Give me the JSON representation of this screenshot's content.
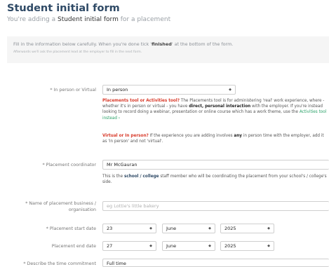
{
  "header": {
    "title": "Student initial form",
    "subtitle_pre": "You're adding a ",
    "subtitle_strong": "Student initial form",
    "subtitle_post": " for a placement"
  },
  "info": {
    "line1_pre": "Fill in the information below carefully. When you're done tick '",
    "line1_strong": "finished",
    "line1_post": "' at the bottom of the form.",
    "line2": "Afterwards we'll ask the placement lead at the employer to fill in the next form."
  },
  "fields": {
    "mode": {
      "label": "* In person or Virtual",
      "value": "In person"
    },
    "coordinator": {
      "label": "* Placement coordinator",
      "value": "Mr McGauran"
    },
    "business": {
      "label": "* Name of placement business / organisation",
      "placeholder": "eg Lottie's little bakery"
    },
    "start": {
      "label": "* Placement start date",
      "day": "23",
      "month": "June",
      "year": "2025"
    },
    "end": {
      "label": "Placement end date",
      "day": "27",
      "month": "June",
      "year": "2025"
    },
    "commitment": {
      "label": "* Describe the time commitment",
      "value": "Full time"
    }
  },
  "help": {
    "tool": {
      "title": "Placements tool or Activities tool?",
      "t1": " The Placements tool is for administering 'real' work experience, where - whether it's in person or virtual - you have ",
      "strong": "direct, personal interaction",
      "t2": " with the employer. If you're instead looking to record doing a webinar, presentation or online course which has a work theme, use the ",
      "link": "Activities tool instead ›"
    },
    "virtual": {
      "title": "Virtual or In person?",
      "t1": " If the experience you are adding involves ",
      "strong": "any",
      "t2": " in person time with the employer, add it as 'In person' and not 'virtual'."
    },
    "coordinator": {
      "t1": "This is the ",
      "strong": "school / college",
      "t2": " staff member who will be coordinating the placement from your school's / college's side."
    }
  },
  "icons": {
    "dropdown": "chevron-down-icon"
  },
  "colors": {
    "title": "#2f4a66",
    "warning": "#d83a2a",
    "link": "#2aa168"
  }
}
